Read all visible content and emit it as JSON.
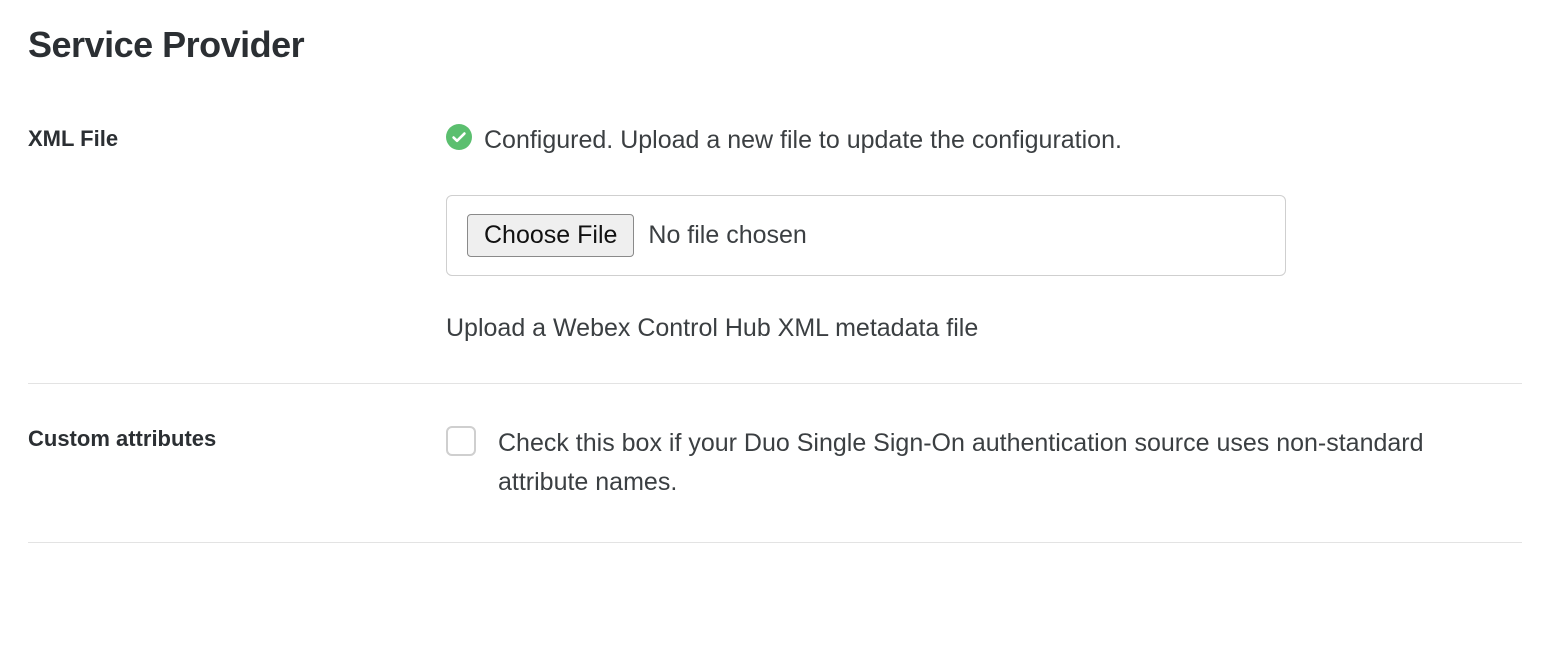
{
  "section": {
    "title": "Service Provider"
  },
  "xml_file": {
    "label": "XML File",
    "status_text": "Configured. Upload a new file to update the configuration.",
    "choose_button": "Choose File",
    "file_status": "No file chosen",
    "help_text": "Upload a Webex Control Hub XML metadata file"
  },
  "custom_attributes": {
    "label": "Custom attributes",
    "checkbox_text": "Check this box if your Duo Single Sign-On authentication source uses non-standard attribute names."
  }
}
